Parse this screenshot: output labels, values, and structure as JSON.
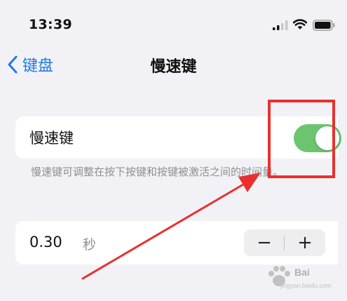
{
  "status_bar": {
    "time": "13:39",
    "icons": [
      "signal-icon",
      "wifi-icon",
      "battery-icon"
    ]
  },
  "nav": {
    "back_label": "键盘",
    "title": "慢速键"
  },
  "slow_keys": {
    "label": "慢速键",
    "enabled": true,
    "toggle_color": "#6cc56e"
  },
  "footnote": "慢速键可调整在按下按键和按键被激活之间的时间量。",
  "delay": {
    "value": "0.30",
    "unit": "秒",
    "minus_label": "−",
    "plus_label": "+"
  },
  "annotation": {
    "highlight_color": "#e8312f"
  },
  "watermark": {
    "brand": "Bai",
    "sub": "jingyan.baidu.com"
  },
  "colors": {
    "accent": "#1f78f0",
    "background": "#f2f2f6",
    "secondary_text": "#8e8e93"
  }
}
